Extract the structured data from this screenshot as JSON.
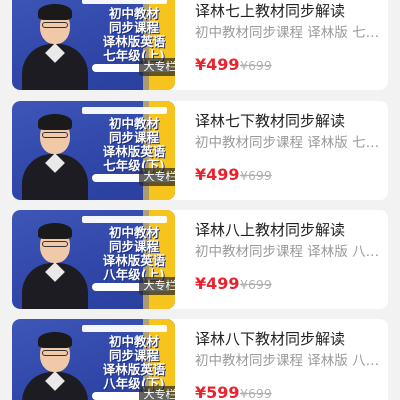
{
  "courses": [
    {
      "title": "译林七上教材同步解读",
      "subtitle": "初中教材同步课程 译林版 七年级...",
      "price": "¥499",
      "original_price": "¥699",
      "tag": "大专栏",
      "cover_title": "初中教材\n同步课程\n译林版英语\n七年级(上)"
    },
    {
      "title": "译林七下教材同步解读",
      "subtitle": "初中教材同步课程 译林版 七年级...",
      "price": "¥499",
      "original_price": "¥699",
      "tag": "大专栏",
      "cover_title": "初中教材\n同步课程\n译林版英语\n七年级(下)"
    },
    {
      "title": "译林八上教材同步解读",
      "subtitle": "初中教材同步课程 译林版 八年级...",
      "price": "¥499",
      "original_price": "¥699",
      "tag": "大专栏",
      "cover_title": "初中教材\n同步课程\n译林版英语\n八年级(上)"
    },
    {
      "title": "译林八下教材同步解读",
      "subtitle": "初中教材同步课程 译林版 八年级...",
      "price": "¥599",
      "original_price": "¥699",
      "tag": "大专栏",
      "cover_title": "初中教材\n同步课程\n译林版英语\n八年级(下)"
    }
  ],
  "colors": {
    "background": "#f2f2f2",
    "card": "#ffffff",
    "price": "#e8232f",
    "cover_blue": "#2f46a8",
    "cover_yellow": "#f6c41d"
  }
}
